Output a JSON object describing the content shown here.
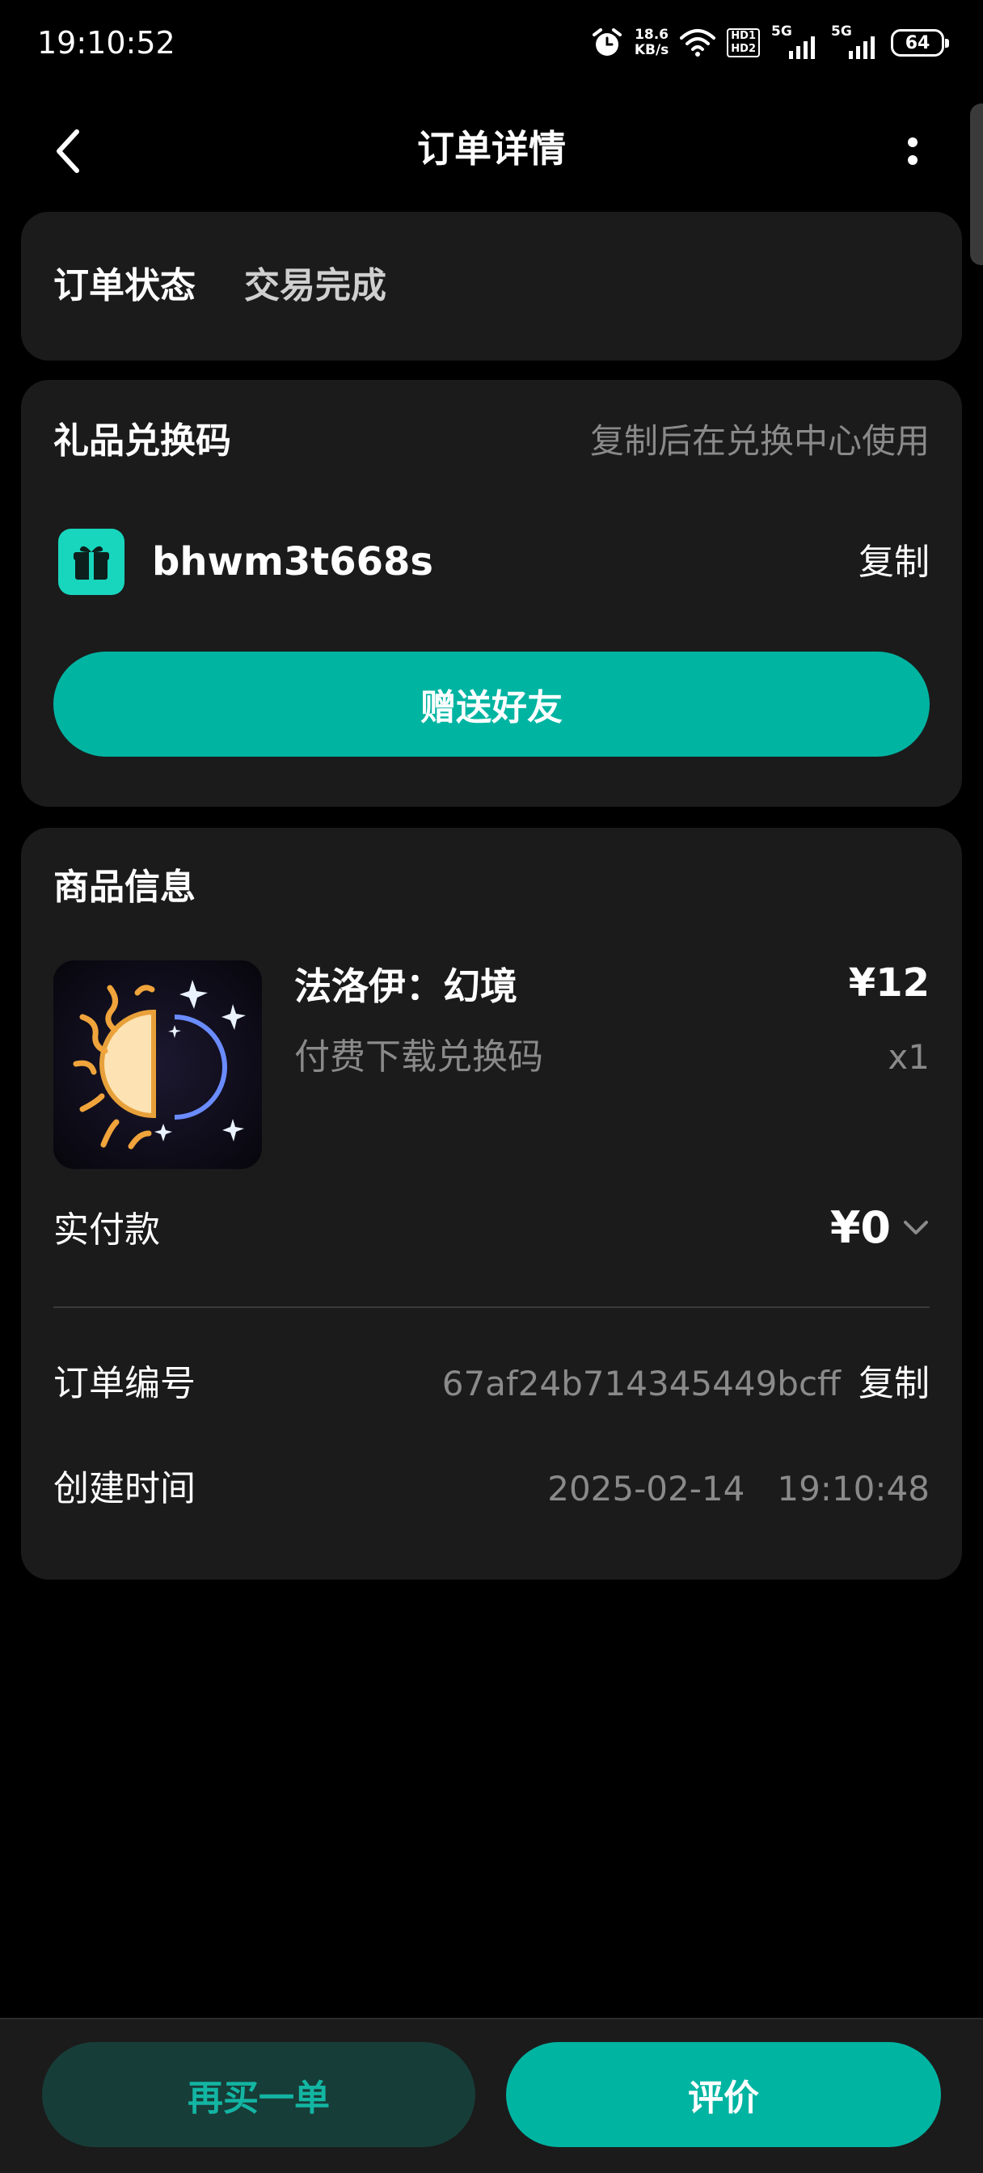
{
  "status_bar": {
    "time": "19:10:52",
    "net_speed_value": "18.6",
    "net_speed_unit": "KB/s",
    "hd1": "HD1",
    "hd2": "HD2",
    "sim1_label": "5G",
    "sim2_label": "5G",
    "battery": "64",
    "icons": [
      "alarm-icon",
      "wifi-icon",
      "signal-icon",
      "signal-icon",
      "battery-icon"
    ]
  },
  "header": {
    "title": "订单详情",
    "back_icon": "back-arrow-icon",
    "more_icon": "more-vertical-icon"
  },
  "order_status": {
    "label": "订单状态",
    "value": "交易完成"
  },
  "gift_code": {
    "title": "礼品兑换码",
    "hint": "复制后在兑换中心使用",
    "code": "bhwm3t668s",
    "copy_label": "复制",
    "send_button": "赠送好友",
    "icon": "gift-icon"
  },
  "product": {
    "section_title": "商品信息",
    "name": "法洛伊：幻境",
    "description": "付费下载兑换码",
    "price": "¥12",
    "quantity": "x1",
    "thumbnail": "sun-moon-app-icon",
    "paid_label": "实付款",
    "paid_amount": "¥0",
    "order_no_label": "订单编号",
    "order_no": "67af24b714345449bcff",
    "order_copy_label": "复制",
    "created_label": "创建时间",
    "created_time": "2025-02-14   19:10:48"
  },
  "bottom_bar": {
    "buy_again": "再买一单",
    "review": "评价"
  },
  "colors": {
    "accent": "#00b4a2",
    "card": "#1b1b1b",
    "background": "#000000",
    "muted_text": "#8a8a8a"
  }
}
